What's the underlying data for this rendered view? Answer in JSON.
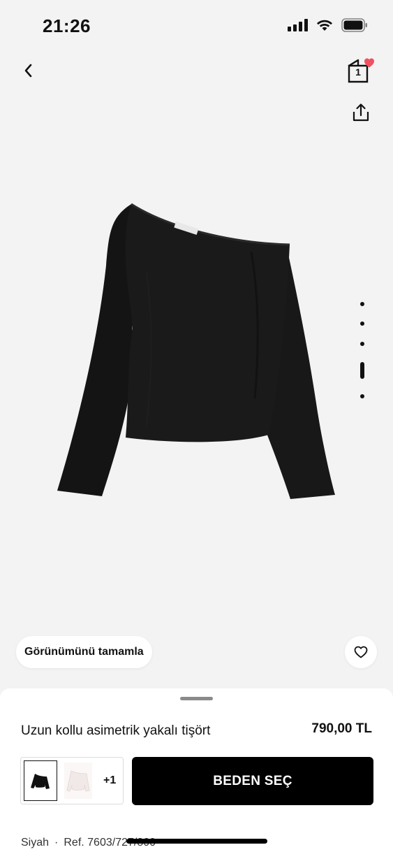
{
  "status_bar": {
    "time": "21:26",
    "icons": [
      "signal-icon",
      "wifi-icon",
      "battery-icon"
    ]
  },
  "nav": {
    "back_icon": "chevron-left-icon",
    "bag_count": "1",
    "bag_badge_color": "#f05061",
    "share_icon": "share-icon"
  },
  "gallery": {
    "image_description_icon": "black-asymmetric-top-image",
    "page_count": 5,
    "active_page": 4
  },
  "actions": {
    "complete_look_label": "Görünümünü tamamla",
    "wishlist_icon": "heart-icon"
  },
  "product": {
    "name": "Uzun kollu asimetrik yakalı tişört",
    "price": "790,00 TL",
    "more_colors": "+1",
    "size_button_label": "BEDEN SEÇ",
    "color_name": "Siyah",
    "separator": "·",
    "reference": "Ref. 7603/727/800"
  },
  "colors": {
    "background": "#f3f3f3",
    "primary_button": "#000000",
    "badge": "#f05061"
  }
}
